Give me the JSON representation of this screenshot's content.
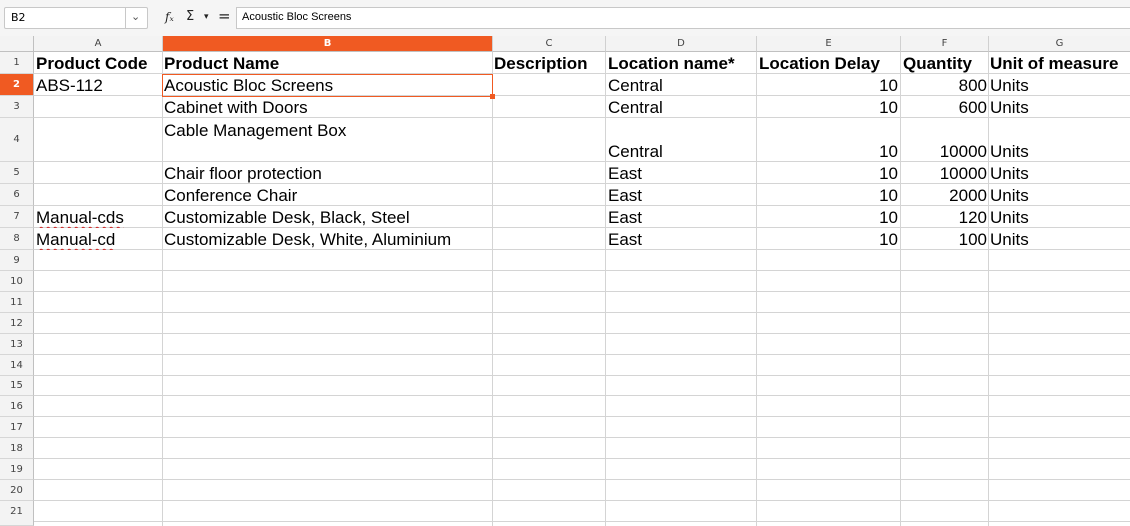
{
  "formula_bar": {
    "cell_ref": "B2",
    "fx_label": "fₓ",
    "sum_label": "Σ",
    "equals_label": "=",
    "content": "Acoustic Bloc Screens"
  },
  "columns": [
    "A",
    "B",
    "C",
    "D",
    "E",
    "F",
    "G"
  ],
  "selected_column": "B",
  "row_numbers": [
    "1",
    "2",
    "3",
    "4",
    "5",
    "6",
    "7",
    "8",
    "9",
    "10",
    "11",
    "12",
    "13",
    "14",
    "15",
    "16",
    "17",
    "18",
    "19",
    "20",
    "21"
  ],
  "selected_row": "2",
  "headers": {
    "a": "Product Code",
    "b": "Product Name",
    "c": "Description",
    "d": "Location name*",
    "e": "Location Delay",
    "f": "Quantity",
    "g": "Unit of measure"
  },
  "rows": [
    {
      "a": "ABS-112",
      "b": "Acoustic Bloc Screens",
      "c": "",
      "d": "Central",
      "e": "10",
      "f": "800",
      "g": "Units"
    },
    {
      "a": "",
      "b": "Cabinet with Doors",
      "c": "",
      "d": "Central",
      "e": "10",
      "f": "600",
      "g": "Units"
    },
    {
      "a": "",
      "b": "Cable Management Box",
      "c": "",
      "d": "Central",
      "e": "10",
      "f": "10000",
      "g": "Units"
    },
    {
      "a": "",
      "b": "Chair floor protection",
      "c": "",
      "d": "East",
      "e": "10",
      "f": "10000",
      "g": "Units"
    },
    {
      "a": "",
      "b": "Conference Chair",
      "c": "",
      "d": "East",
      "e": "10",
      "f": "2000",
      "g": "Units"
    },
    {
      "a": "Manual-cds",
      "b": "Customizable Desk, Black, Steel",
      "c": "",
      "d": "East",
      "e": "10",
      "f": "120",
      "g": "Units"
    },
    {
      "a": "Manual-cd",
      "b": "Customizable Desk, White, Aluminium",
      "c": "",
      "d": "East",
      "e": "10",
      "f": "100",
      "g": "Units"
    }
  ],
  "colors": {
    "selection": "#f05a22",
    "header_bg": "#f3f3f3",
    "grid": "#d4d4d4"
  }
}
